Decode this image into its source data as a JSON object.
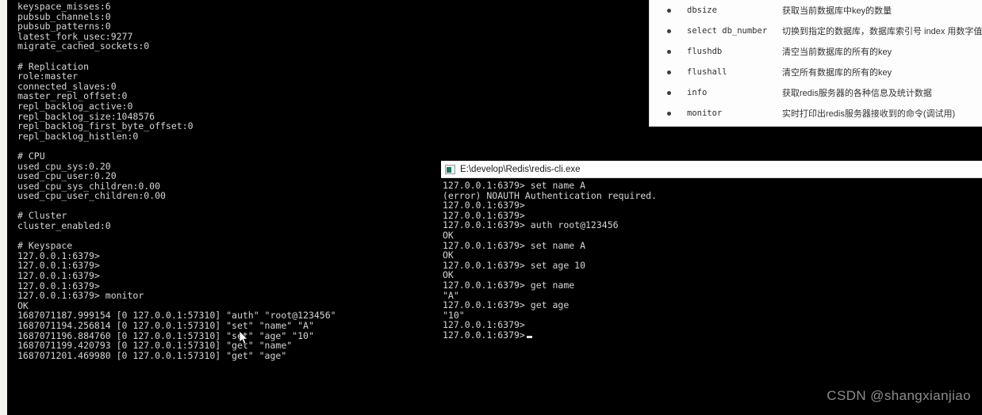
{
  "left_console": {
    "name": "redis-server-monitor-console",
    "lines": [
      "keyspace_misses:6",
      "pubsub_channels:0",
      "pubsub_patterns:0",
      "latest_fork_usec:9277",
      "migrate_cached_sockets:0",
      "",
      "# Replication",
      "role:master",
      "connected_slaves:0",
      "master_repl_offset:0",
      "repl_backlog_active:0",
      "repl_backlog_size:1048576",
      "repl_backlog_first_byte_offset:0",
      "repl_backlog_histlen:0",
      "",
      "# CPU",
      "used_cpu_sys:0.20",
      "used_cpu_user:0.20",
      "used_cpu_sys_children:0.00",
      "used_cpu_user_children:0.00",
      "",
      "# Cluster",
      "cluster_enabled:0",
      "",
      "# Keyspace",
      "127.0.0.1:6379>",
      "127.0.0.1:6379>",
      "127.0.0.1:6379>",
      "127.0.0.1:6379>",
      "127.0.0.1:6379> monitor",
      "OK",
      "1687071187.999154 [0 127.0.0.1:57310] \"auth\" \"root@123456\"",
      "1687071194.256814 [0 127.0.0.1:57310] \"set\" \"name\" \"A\"",
      "1687071196.884760 [0 127.0.0.1:57310] \"set\" \"age\" \"10\"",
      "1687071199.420793 [0 127.0.0.1:57310] \"get\" \"name\"",
      "1687071201.469980 [0 127.0.0.1:57310] \"get\" \"age\""
    ]
  },
  "cli_window": {
    "title": "E:\\develop\\Redis\\redis-cli.exe",
    "icon": "console-icon",
    "lines": [
      "127.0.0.1:6379> set name A",
      "(error) NOAUTH Authentication required.",
      "127.0.0.1:6379>",
      "127.0.0.1:6379>",
      "127.0.0.1:6379> auth root@123456",
      "OK",
      "127.0.0.1:6379> set name A",
      "OK",
      "127.0.0.1:6379> set age 10",
      "OK",
      "127.0.0.1:6379> get name",
      "\"A\"",
      "127.0.0.1:6379> get age",
      "\"10\"",
      "127.0.0.1:6379>"
    ],
    "prompt": "127.0.0.1:6379>"
  },
  "doc_panel": {
    "commands": [
      {
        "cmd": "dbsize",
        "desc": "获取当前数据库中key的数量"
      },
      {
        "cmd": "select db_number",
        "desc": "切换到指定的数据库，数据库索引号 index 用数字值指定，"
      },
      {
        "cmd": "flushdb",
        "desc": "清空当前数据库的所有的key"
      },
      {
        "cmd": "flushall",
        "desc": "清空所有数据库的所有的key"
      },
      {
        "cmd": "info",
        "desc": "获取redis服务器的各种信息及统计数据"
      },
      {
        "cmd": "monitor",
        "desc": "实时打印出redis服务器接收到的命令(调试用)"
      }
    ]
  },
  "watermark": {
    "text": "CSDN @shangxianjiao"
  },
  "colors": {
    "terminal_bg": "#000000",
    "terminal_text": "#d6d6d6",
    "panel_bg": "#fdfdfd",
    "titlebar_bg": "#ffffff",
    "watermark": "#8c8c8c",
    "icon_accent": "#1d7a61"
  }
}
